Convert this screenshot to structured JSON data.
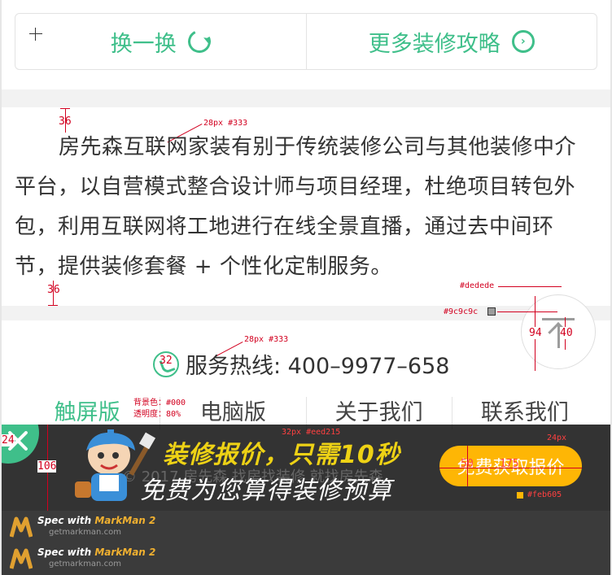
{
  "top_buttons": {
    "shuffle_label": "换一换",
    "more_label": "更多装修攻略",
    "more_arrow": "›"
  },
  "intro": {
    "text": "房先森互联网家装有别于传统装修公司与其他装修中介平台，以自营模式整合设计师与项目经理，杜绝项目转包外包，利用互联网将工地进行在线全景直播，通过去中间环节，提供装修套餐 + 个性化定制服务。"
  },
  "hotline": {
    "label": "服务热线: 400–9977–658"
  },
  "footer_nav": {
    "items": [
      "触屏版",
      "电脑版",
      "关于我们",
      "联系我们"
    ],
    "copyright": "© 2017 房先森 找房找装修 就找房先森"
  },
  "banner": {
    "headline": "装修报价，只需10秒",
    "subline": "免费为您算得装修预算",
    "cta_label": "免费获取报价"
  },
  "annotations": {
    "gap_top": "36",
    "font_note_1": "28px #333",
    "gap_bottom": "36",
    "border_color": "#dedede",
    "glyph_color": "#9c9c9c",
    "circle_size": "94",
    "glyph_size": "40",
    "font_note_2": "28px #333",
    "icon_size": "32",
    "bg_color_note": "背景色：#000",
    "opacity_note": "透明度：80%",
    "close_size": "24",
    "banner_height": "106",
    "headline_note": "32px #eed215",
    "radius_note": "24px",
    "cta_height": "50",
    "cta_width": "175",
    "cta_color": "#feb605"
  },
  "markman": {
    "title_prefix": "Spec with ",
    "title_brand": "MarkMan 2",
    "site": "getmarkman.com"
  },
  "colors": {
    "accent_green": "#3fbf8a",
    "headline_yellow": "#eed215",
    "cta_orange": "#feb605",
    "annotation_red": "#d2001f"
  },
  "icons": {
    "refresh": "refresh-icon",
    "arrow": "arrow-right-circle-icon",
    "phone": "phone-icon",
    "close": "close-icon",
    "back_to_top": "back-to-top-icon"
  }
}
